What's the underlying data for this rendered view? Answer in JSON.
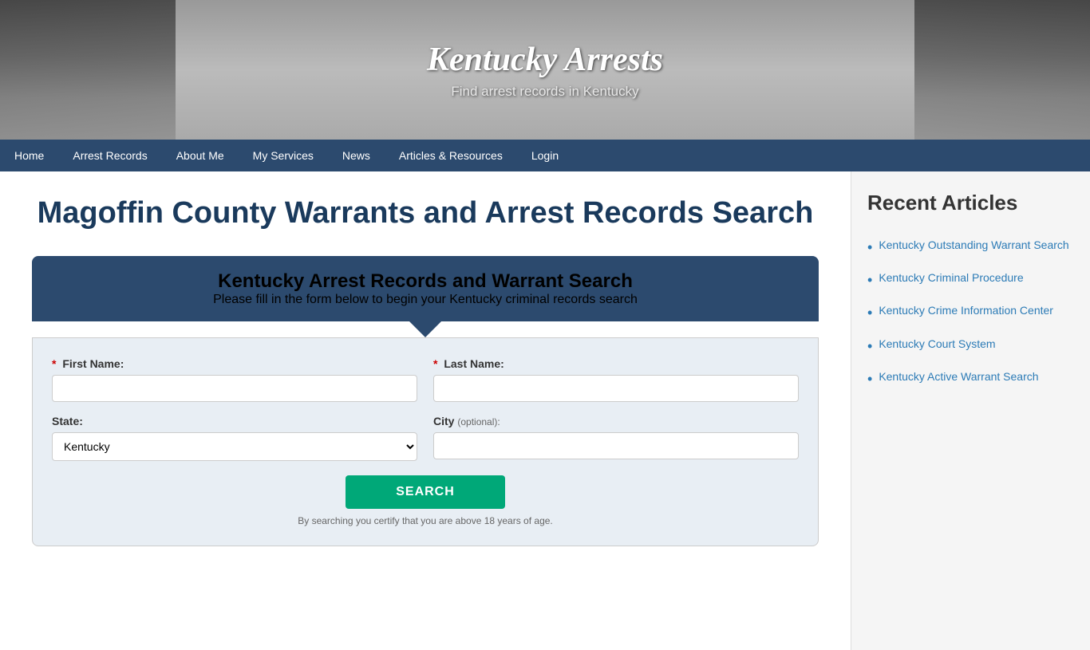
{
  "header": {
    "title": "Kentucky Arrests",
    "subtitle": "Find arrest records in Kentucky"
  },
  "nav": {
    "items": [
      {
        "label": "Home",
        "name": "nav-home"
      },
      {
        "label": "Arrest Records",
        "name": "nav-arrest-records"
      },
      {
        "label": "About Me",
        "name": "nav-about-me"
      },
      {
        "label": "My Services",
        "name": "nav-my-services"
      },
      {
        "label": "News",
        "name": "nav-news"
      },
      {
        "label": "Articles & Resources",
        "name": "nav-articles"
      },
      {
        "label": "Login",
        "name": "nav-login"
      }
    ]
  },
  "main": {
    "page_title": "Magoffin County Warrants and Arrest Records Search",
    "search_box": {
      "heading": "Kentucky Arrest Records and Warrant Search",
      "subheading": "Please fill in the form below to begin your Kentucky criminal records search",
      "first_name_label": "First Name:",
      "last_name_label": "Last Name:",
      "state_label": "State:",
      "city_label": "City",
      "city_optional": "(optional):",
      "state_value": "Kentucky",
      "search_button": "SEARCH",
      "disclaimer": "By searching you certify that you are above 18 years of age."
    }
  },
  "sidebar": {
    "title": "Recent Articles",
    "articles": [
      {
        "label": "Kentucky Outstanding Warrant Search"
      },
      {
        "label": "Kentucky Criminal Procedure"
      },
      {
        "label": "Kentucky Crime Information Center"
      },
      {
        "label": "Kentucky Court System"
      },
      {
        "label": "Kentucky Active Warrant Search"
      }
    ]
  }
}
